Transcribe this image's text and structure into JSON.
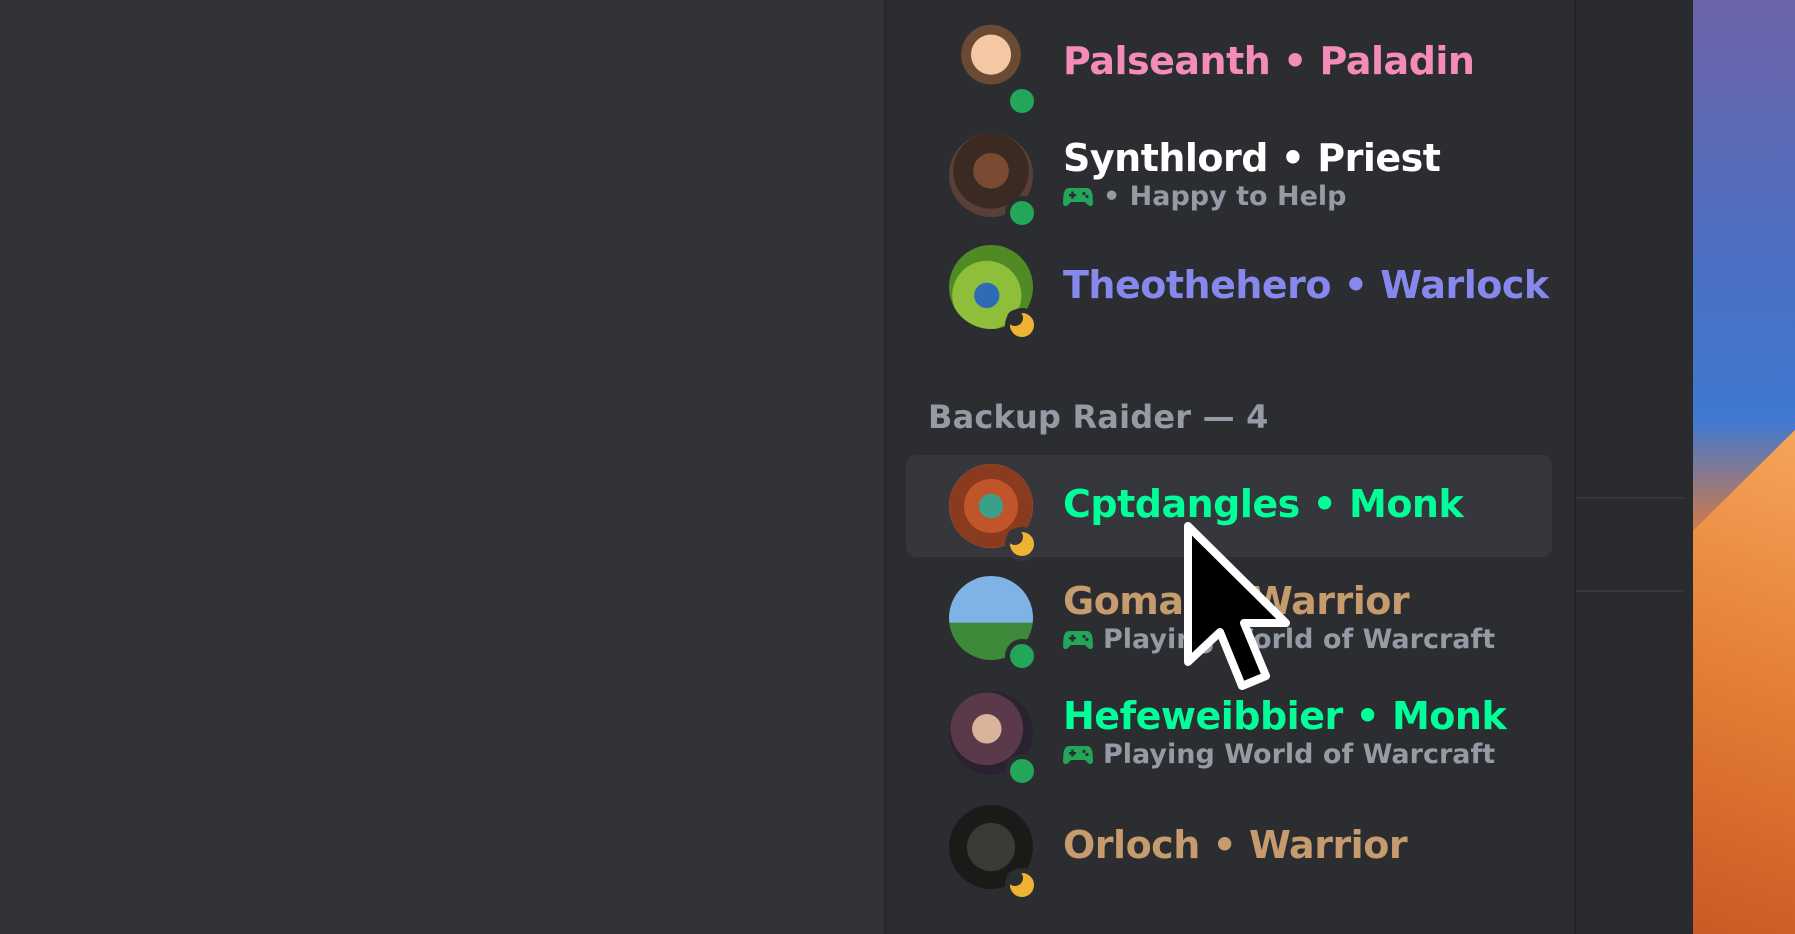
{
  "members_top": [
    {
      "name": "Palseanth • Paladin",
      "color": "#f48cba",
      "status": "online",
      "activity": ""
    },
    {
      "name": "Synthlord • Priest",
      "color": "#ffffff",
      "status": "online",
      "activity": "• Happy to Help"
    },
    {
      "name": "Theothehero • Warlock",
      "color": "#8788ee",
      "status": "idle",
      "activity": ""
    }
  ],
  "section": {
    "label": "Backup Raider — 4"
  },
  "members_backup": [
    {
      "name": "Cptdangles • Monk",
      "color": "#00ff98",
      "status": "idle",
      "activity": ""
    },
    {
      "name": "Gomar • Warrior",
      "color": "#c69b6d",
      "status": "online",
      "activity": "Playing World of Warcraft"
    },
    {
      "name": "Hefeweibbier • Monk",
      "color": "#00ff98",
      "status": "online",
      "activity": "Playing World of Warcraft"
    },
    {
      "name": "Orloch • Warrior",
      "color": "#c69b6d",
      "status": "idle",
      "activity": ""
    }
  ],
  "icons": {
    "activity": "gamepad-icon",
    "pointer": "mouse-cursor-icon"
  }
}
